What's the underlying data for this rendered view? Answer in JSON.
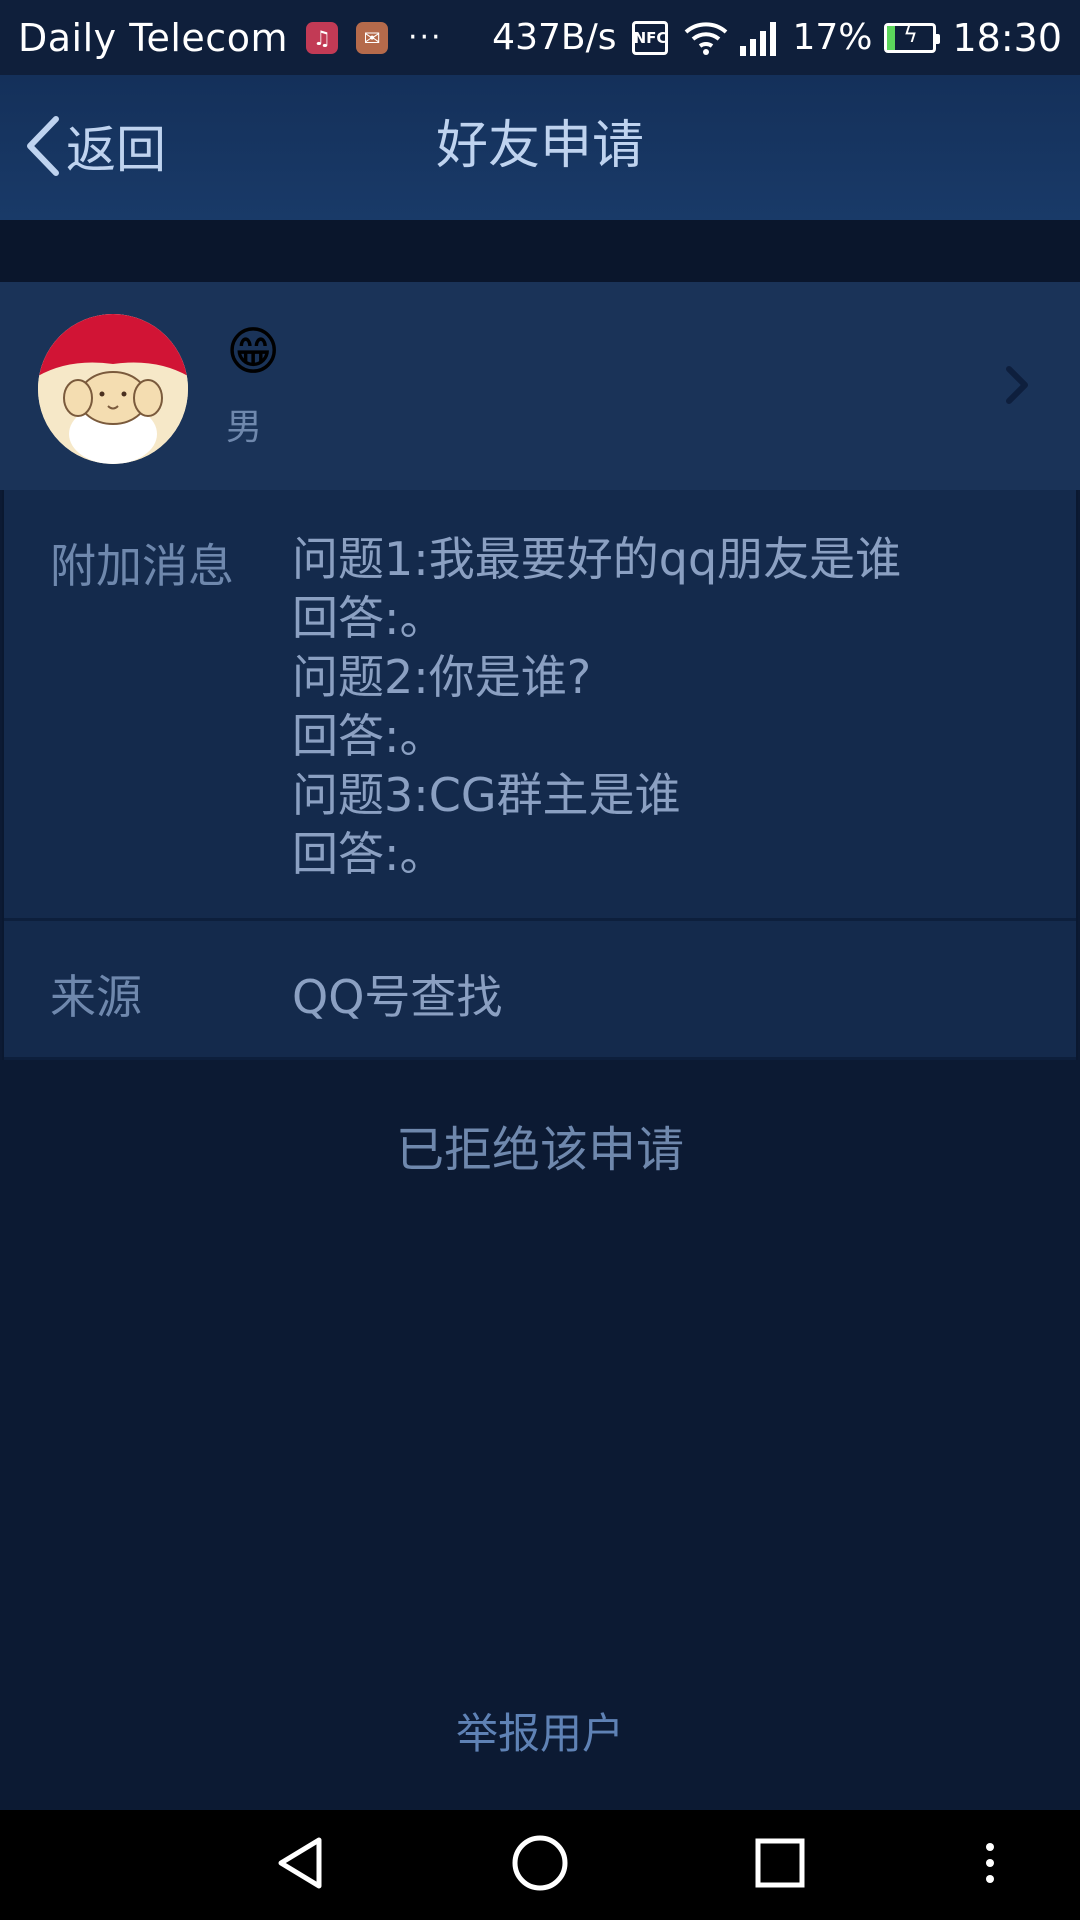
{
  "status_bar": {
    "carrier": "Daily Telecom",
    "notification_icons": [
      "music-icon",
      "mail-icon"
    ],
    "more_indicator": "···",
    "net_speed": "437B/s",
    "nfc_label": "NFC",
    "battery_percent": "17%",
    "battery_level": 0.17,
    "time": "18:30"
  },
  "header": {
    "back_label": "返回",
    "title": "好友申请"
  },
  "profile": {
    "nickname": "😁",
    "gender": "男"
  },
  "request": {
    "message_label": "附加消息",
    "message_lines": [
      "问题1:我最要好的qq朋友是谁",
      "回答:。",
      "问题2:你是谁?",
      "回答:。",
      "问题3:CG群主是谁",
      "回答:。"
    ],
    "source_label": "来源",
    "source_value": "QQ号查找",
    "status_text": "已拒绝该申请"
  },
  "footer": {
    "report_label": "举报用户"
  },
  "colors": {
    "background": "#0c1a33",
    "header": "#193a68",
    "profile_row": "#1a3358",
    "panel": "#142a4c",
    "label_text": "#6f88ad",
    "body_text": "#8ba0c2",
    "link_text": "#5f82b5"
  }
}
